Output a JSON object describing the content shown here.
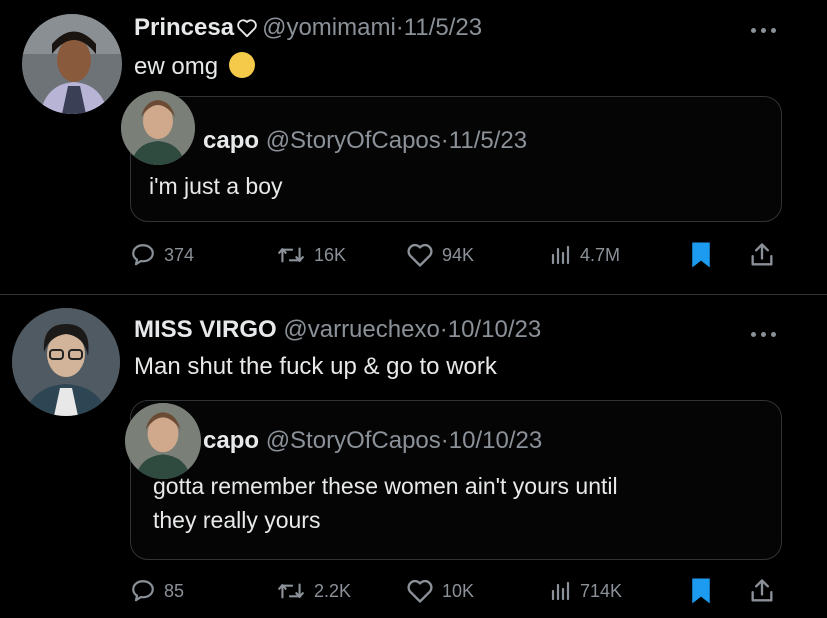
{
  "colors": {
    "background": "#000000",
    "text_primary": "#e7e9ea",
    "text_secondary": "#8b9198",
    "border": "#2f3336",
    "bookmark_active": "#1d9bf0"
  },
  "tweets": [
    {
      "name": "Princesa",
      "name_icon": "heart-outline-icon",
      "handle": "@yomimami",
      "separator": "·",
      "date": "11/5/23",
      "text": "ew omg",
      "emoji": "😷",
      "quote": {
        "name": "capo",
        "handle": "@StoryOfCapos",
        "separator": "·",
        "date": "11/5/23",
        "lines": [
          "i'm just a boy"
        ]
      },
      "stats": {
        "replies": "374",
        "reposts": "16K",
        "likes": "94K",
        "views": "4.7M"
      }
    },
    {
      "name": "MISS VIRGO",
      "handle": "@varruechexo",
      "separator": "·",
      "date": "10/10/23",
      "text": "Man shut the fuck up & go to work",
      "quote": {
        "name": "capo",
        "handle": "@StoryOfCapos",
        "separator": "·",
        "date": "10/10/23",
        "lines": [
          "gotta remember these women ain't yours until",
          "they really yours"
        ]
      },
      "stats": {
        "replies": "85",
        "reposts": "2.2K",
        "likes": "10K",
        "views": "714K"
      }
    }
  ]
}
